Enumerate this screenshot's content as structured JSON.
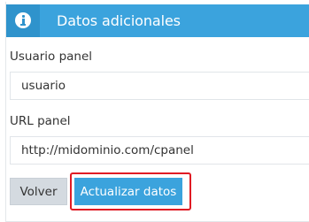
{
  "panel": {
    "title": "Datos adicionales",
    "icon": "info-icon"
  },
  "fields": {
    "user_label": "Usuario panel",
    "user_value": "usuario",
    "url_label": "URL panel",
    "url_value": "http://midominio.com/cpanel"
  },
  "buttons": {
    "back_label": "Volver",
    "update_label": "Actualizar datos"
  },
  "colors": {
    "header": "#3ba3dd",
    "header_icon_bg": "#2f93cc",
    "primary_button": "#3ba3dd",
    "secondary_button": "#d4dae0",
    "highlight": "#e01b24"
  }
}
